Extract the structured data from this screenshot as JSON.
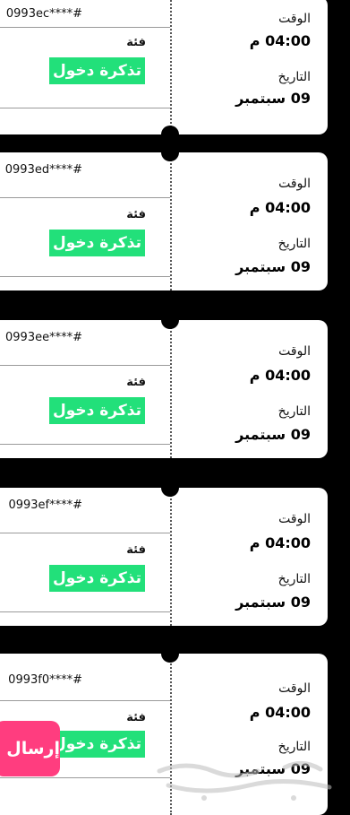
{
  "tickets": [
    {
      "serial": "0993ec****#",
      "category_label": "فئة",
      "category": "تذكرة دخول",
      "time_label": "الوقت",
      "time": "04:00 م",
      "date_label": "التاريخ",
      "date": "09 سبتمبر"
    },
    {
      "serial": "0993ed****#",
      "category_label": "فئة",
      "category": "تذكرة دخول",
      "time_label": "الوقت",
      "time": "04:00 م",
      "date_label": "التاريخ",
      "date": "09 سبتمبر"
    },
    {
      "serial": "0993ee****#",
      "category_label": "فئة",
      "category": "تذكرة دخول",
      "time_label": "الوقت",
      "time": "04:00 م",
      "date_label": "التاريخ",
      "date": "09 سبتمبر"
    },
    {
      "serial": "0993ef****#",
      "category_label": "فئة",
      "category": "تذكرة دخول",
      "time_label": "الوقت",
      "time": "04:00 م",
      "date_label": "التاريخ",
      "date": "09 سبتمبر"
    },
    {
      "serial": "0993f0****#",
      "category_label": "فئة",
      "category": "تذكرة دخول",
      "time_label": "الوقت",
      "time": "04:00 م",
      "date_label": "التاريخ",
      "date": "09 سبتمبر"
    }
  ],
  "send_button": {
    "label": "إرسال"
  },
  "watermark": {
    "text": "حراج"
  },
  "colors": {
    "badge": "#22e07a",
    "send_button": "#ff3d7f",
    "background": "#000000"
  }
}
